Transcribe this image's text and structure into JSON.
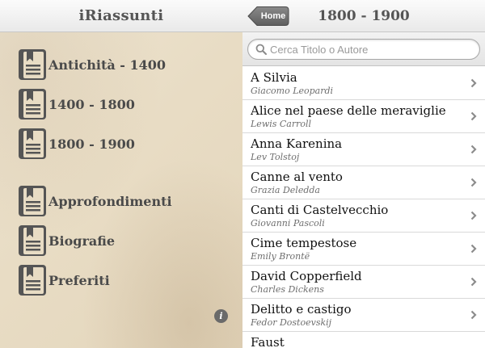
{
  "left": {
    "title": "iRiassunti",
    "menu": [
      {
        "label": "Antichità - 1400",
        "icon": "book-icon"
      },
      {
        "label": "1400 - 1800",
        "icon": "book-icon"
      },
      {
        "label": "1800 - 1900",
        "icon": "book-icon"
      },
      {
        "label": "Approfondimenti",
        "icon": "book-icon"
      },
      {
        "label": "Biografie",
        "icon": "book-icon"
      },
      {
        "label": "Preferiti",
        "icon": "book-icon"
      }
    ],
    "info_glyph": "i"
  },
  "right": {
    "home_label": "Home",
    "title": "1800 - 1900",
    "search_placeholder": "Cerca Titolo o Autore",
    "books": [
      {
        "title": "A Silvia",
        "author": "Giacomo Leopardi"
      },
      {
        "title": "Alice nel paese delle meraviglie",
        "author": "Lewis Carroll"
      },
      {
        "title": "Anna Karenina",
        "author": "Lev Tolstoj"
      },
      {
        "title": "Canne al vento",
        "author": "Grazia Deledda"
      },
      {
        "title": "Canti di Castelvecchio",
        "author": "Giovanni Pascoli"
      },
      {
        "title": "Cime tempestose",
        "author": "Emily Brontë"
      },
      {
        "title": "David Copperfield",
        "author": "Charles Dickens"
      },
      {
        "title": "Delitto e castigo",
        "author": "Fedor Dostoevskij"
      },
      {
        "title": "Faust",
        "author": ""
      }
    ]
  },
  "colors": {
    "header_text": "#555555",
    "menu_text": "#4a4a4a",
    "icon_fill": "#555555",
    "home_button": "#6f6f6f",
    "parchment": "#e8dcc4"
  }
}
